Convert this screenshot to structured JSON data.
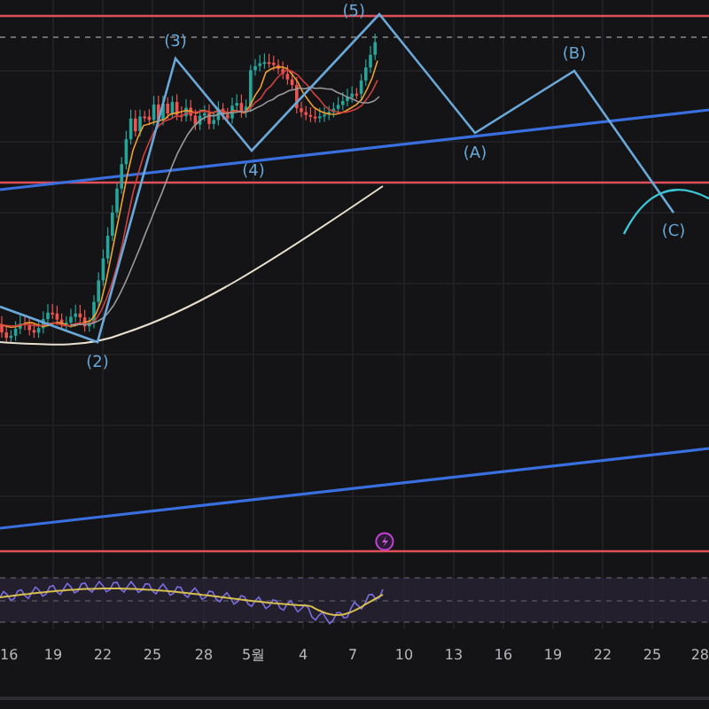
{
  "chart": {
    "wave_labels": [
      {
        "text": "(5)"
      },
      {
        "text": "(3)"
      },
      {
        "text": "(B)"
      },
      {
        "text": "(A)"
      },
      {
        "text": "(4)"
      },
      {
        "text": "(C)"
      },
      {
        "text": "(2)"
      }
    ]
  },
  "time_axis": {
    "labels": [
      "16",
      "19",
      "22",
      "25",
      "28",
      "5월",
      "4",
      "7",
      "10",
      "13",
      "16",
      "19",
      "22",
      "25",
      "28"
    ]
  }
}
